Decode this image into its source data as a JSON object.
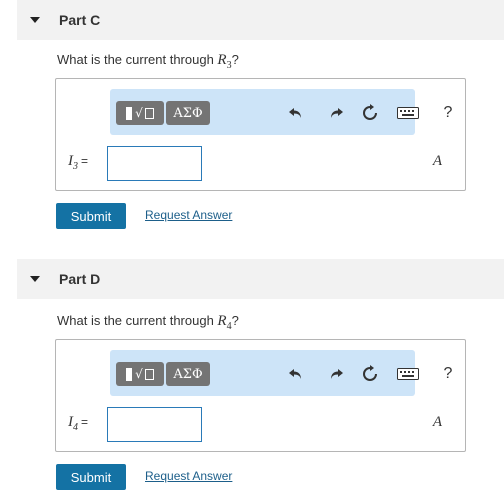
{
  "parts": [
    {
      "title": "Part C",
      "question_prefix": "What is the current through ",
      "question_var": "R",
      "question_sub": "3",
      "question_suffix": "?",
      "toolbar": {
        "greek_label": "ΑΣΦ",
        "help_label": "?"
      },
      "answer": {
        "var": "I",
        "sub": "3",
        "eq": "=",
        "value": "",
        "unit": "A"
      },
      "submit_label": "Submit",
      "request_label": "Request Answer"
    },
    {
      "title": "Part D",
      "question_prefix": "What is the current through ",
      "question_var": "R",
      "question_sub": "4",
      "question_suffix": "?",
      "toolbar": {
        "greek_label": "ΑΣΦ",
        "help_label": "?"
      },
      "answer": {
        "var": "I",
        "sub": "4",
        "eq": "=",
        "value": "",
        "unit": "A"
      },
      "submit_label": "Submit",
      "request_label": "Request Answer"
    }
  ],
  "icons": {
    "undo": "undo-icon",
    "redo": "redo-icon",
    "reset": "reset-icon",
    "keyboard": "keyboard-icon",
    "help": "help-icon",
    "caret": "caret-down-icon"
  },
  "colors": {
    "header_bg": "#f2f2f2",
    "toolbar_bg": "#cde4f8",
    "submit_bg": "#1472a4",
    "link": "#1d5f8a",
    "input_border": "#2a7ab8"
  }
}
